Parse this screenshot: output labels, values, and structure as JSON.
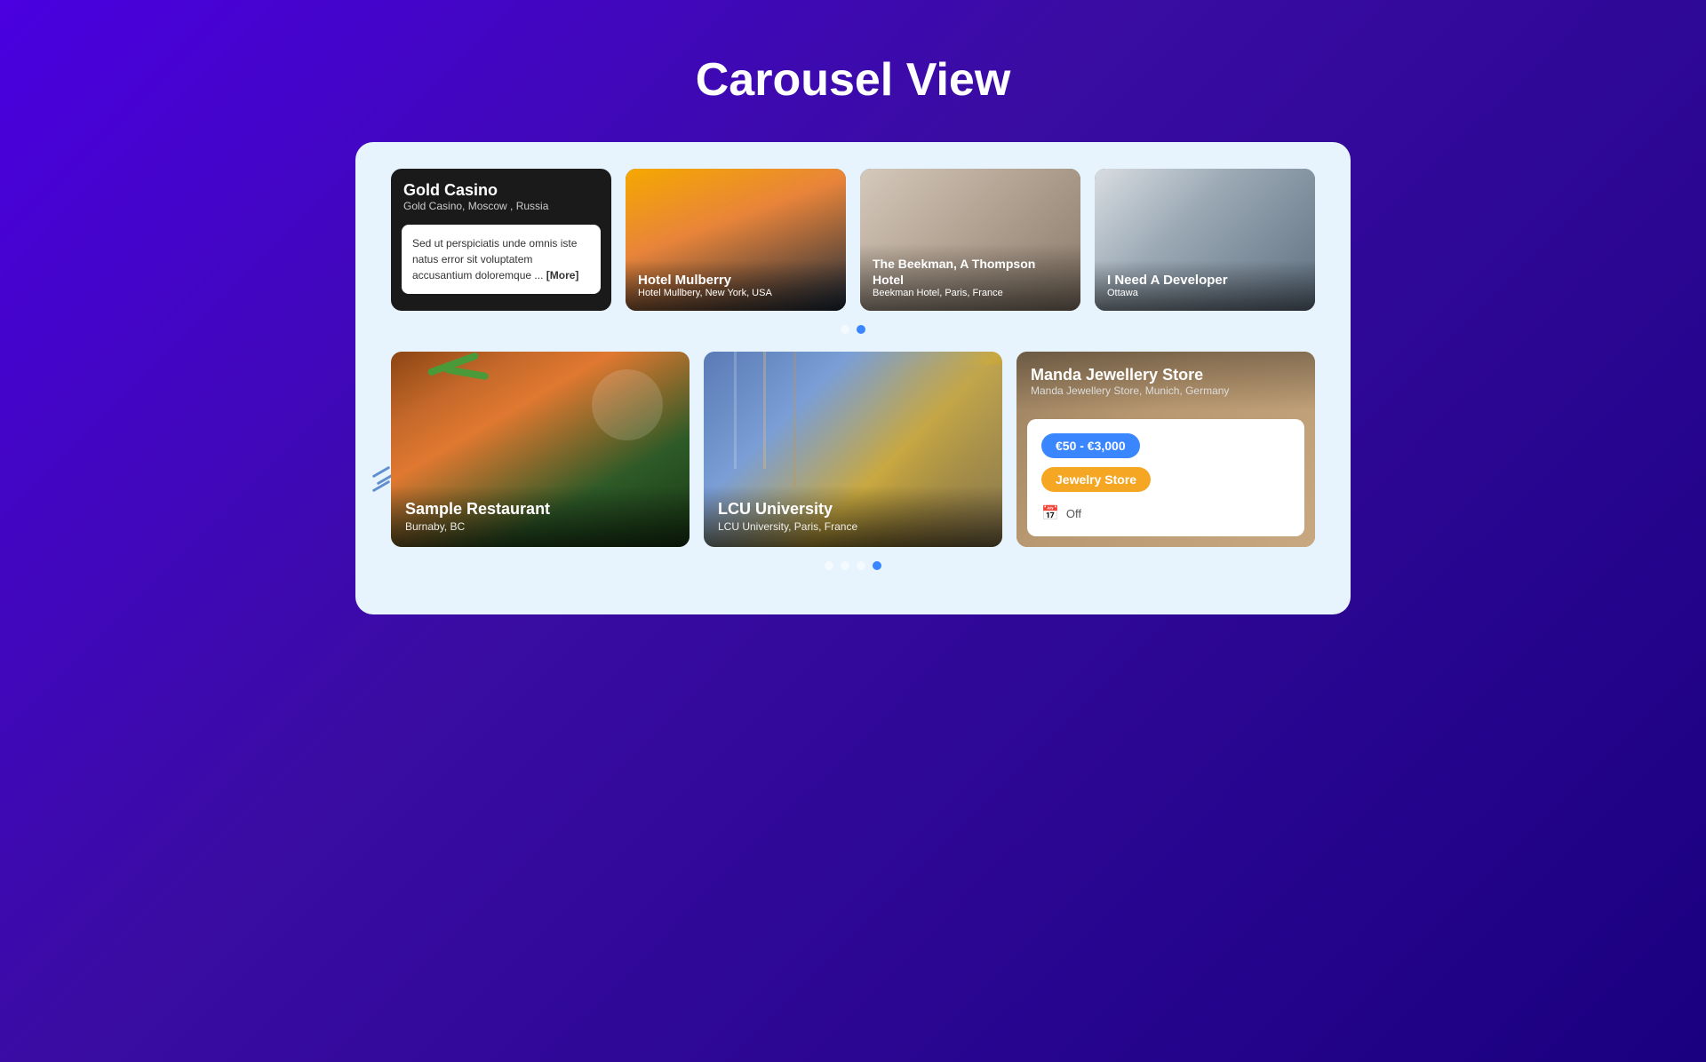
{
  "page": {
    "title": "Carousel View",
    "background_color": "#4a00e0"
  },
  "carousel1": {
    "cards": [
      {
        "id": "gold-casino",
        "title": "Gold Casino",
        "subtitle": "Gold Casino, Moscow , Russia",
        "description": "Sed ut perspiciatis unde omnis iste natus error sit voluptatem accusantium doloremque ...",
        "more_label": "[More]",
        "type": "text-card"
      },
      {
        "id": "hotel-mulberry",
        "title": "Hotel Mulberry",
        "subtitle": "Hotel Mullbery, New York, USA",
        "type": "image-card",
        "img_class": "img-hotel-mulberry"
      },
      {
        "id": "beekman-hotel",
        "title": "The Beekman, A Thompson Hotel",
        "subtitle": "Beekman Hotel, Paris, France",
        "type": "image-card",
        "img_class": "img-beekman"
      },
      {
        "id": "i-need-developer",
        "title": "I Need A Developer",
        "subtitle": "Ottawa",
        "type": "image-card",
        "img_class": "img-developer"
      }
    ],
    "dots": [
      {
        "active": false
      },
      {
        "active": true
      }
    ]
  },
  "carousel2": {
    "cards": [
      {
        "id": "sample-restaurant",
        "title": "Sample Restaurant",
        "subtitle": "Burnaby, BC",
        "type": "image-card",
        "img_class": "img-restaurant"
      },
      {
        "id": "lcu-university",
        "title": "LCU University",
        "subtitle": "LCU University, Paris, France",
        "type": "image-card",
        "img_class": "img-university"
      },
      {
        "id": "manda-jewellery",
        "title": "Manda Jewellery Store",
        "subtitle": "Manda Jewellery Store, Munich, Germany",
        "price": "€50 - €3,000",
        "category": "Jewelry Store",
        "status_label": "Off",
        "type": "detail-card"
      }
    ],
    "dots": [
      {
        "active": false
      },
      {
        "active": false
      },
      {
        "active": false
      },
      {
        "active": true
      }
    ]
  }
}
